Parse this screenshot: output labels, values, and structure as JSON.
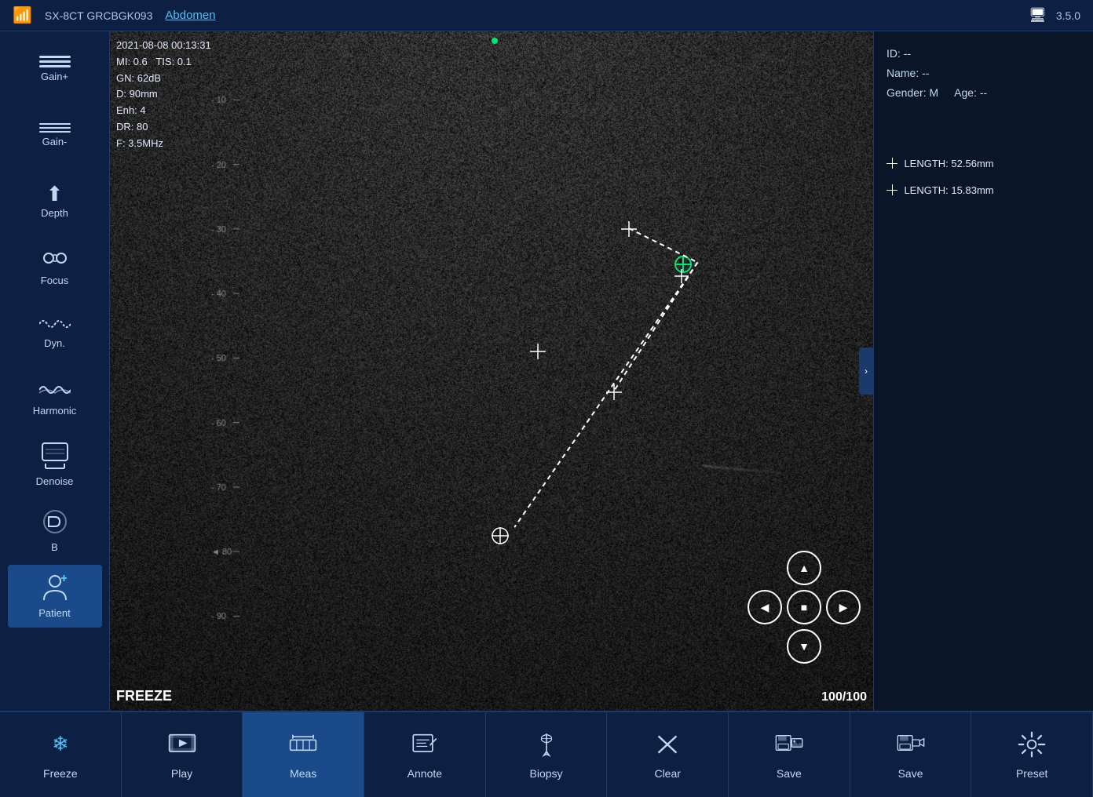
{
  "topbar": {
    "probe": "SX-8CT GRCBGK093",
    "exam": "Abdomen",
    "version": "3.5.0",
    "wifi_icon": "wifi-icon"
  },
  "overlay": {
    "datetime": "2021-08-08 00:13:31",
    "mi": "MI: 0.6",
    "tis": "TIS: 0.1",
    "gn": "GN: 62dB",
    "depth": "D: 90mm",
    "enh": "Enh: 4",
    "dr": "DR: 80",
    "freq": "F: 3.5MHz"
  },
  "patient": {
    "id_label": "ID: --",
    "name_label": "Name: --",
    "gender_label": "Gender: M",
    "age_label": "Age: --"
  },
  "measurements": [
    {
      "label": "LENGTH: 52.56mm"
    },
    {
      "label": "LENGTH: 15.83mm"
    }
  ],
  "viewport": {
    "freeze_label": "FREEZE",
    "frame_counter": "100/100"
  },
  "depth_marks": [
    {
      "value": "10",
      "pos": 9
    },
    {
      "value": "20",
      "pos": 18
    },
    {
      "value": "30",
      "pos": 28
    },
    {
      "value": "40",
      "pos": 38
    },
    {
      "value": "50",
      "pos": 48
    },
    {
      "value": "60",
      "pos": 58
    },
    {
      "value": "70",
      "pos": 68
    },
    {
      "value": "80",
      "pos": 78
    },
    {
      "value": "90",
      "pos": 88
    }
  ],
  "sidebar": {
    "items": [
      {
        "id": "gain-plus",
        "label": "Gain+",
        "icon": "≡"
      },
      {
        "id": "gain-minus",
        "label": "Gain-",
        "icon": "≡"
      },
      {
        "id": "depth",
        "label": "Depth",
        "icon": "↑"
      },
      {
        "id": "focus",
        "label": "Focus",
        "icon": "⁞⁞"
      },
      {
        "id": "dyn",
        "label": "Dyn.",
        "icon": "∿"
      },
      {
        "id": "harmonic",
        "label": "Harmonic",
        "icon": "∿∿"
      },
      {
        "id": "denoise",
        "label": "Denoise",
        "icon": "▭"
      },
      {
        "id": "b-mode",
        "label": "B",
        "icon": "B"
      },
      {
        "id": "patient",
        "label": "Patient",
        "icon": "👤"
      }
    ]
  },
  "toolbar": {
    "items": [
      {
        "id": "freeze",
        "label": "Freeze",
        "icon": "freeze"
      },
      {
        "id": "play",
        "label": "Play",
        "icon": "play"
      },
      {
        "id": "meas",
        "label": "Meas",
        "icon": "meas"
      },
      {
        "id": "annote",
        "label": "Annote",
        "icon": "annote"
      },
      {
        "id": "biopsy",
        "label": "Biopsy",
        "icon": "biopsy"
      },
      {
        "id": "clear",
        "label": "Clear",
        "icon": "clear"
      },
      {
        "id": "save1",
        "label": "Save",
        "icon": "save1"
      },
      {
        "id": "save2",
        "label": "Save",
        "icon": "save2"
      },
      {
        "id": "preset",
        "label": "Preset",
        "icon": "preset"
      }
    ]
  },
  "playback": {
    "up": "▲",
    "left": "◀",
    "stop": "■",
    "right": "▶",
    "down": "▼"
  }
}
